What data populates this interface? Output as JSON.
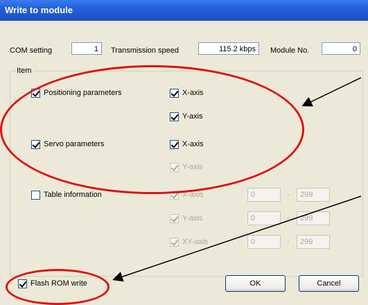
{
  "window": {
    "title": "Write to module"
  },
  "top": {
    "com_label": "COM setting",
    "com_value": "1",
    "speed_label": "Transmission speed",
    "speed_value": "115.2 kbps",
    "module_label": "Module No.",
    "module_value": "0"
  },
  "item_group": {
    "title": "Item"
  },
  "positioning": {
    "label": "Positioning parameters",
    "x": "X-axis",
    "y": "Y-axis"
  },
  "servo": {
    "label": "Servo parameters",
    "x": "X-axis",
    "y": "Y-axis"
  },
  "table": {
    "label": "Table information",
    "x": "X-axis",
    "y": "Y-axis",
    "xy": "XY-axis",
    "from": "0",
    "to": "299",
    "sep": "-"
  },
  "flash": {
    "label": "Flash ROM write"
  },
  "buttons": {
    "ok": "OK",
    "cancel": "Cancel"
  },
  "annotation_color": "#e01010"
}
